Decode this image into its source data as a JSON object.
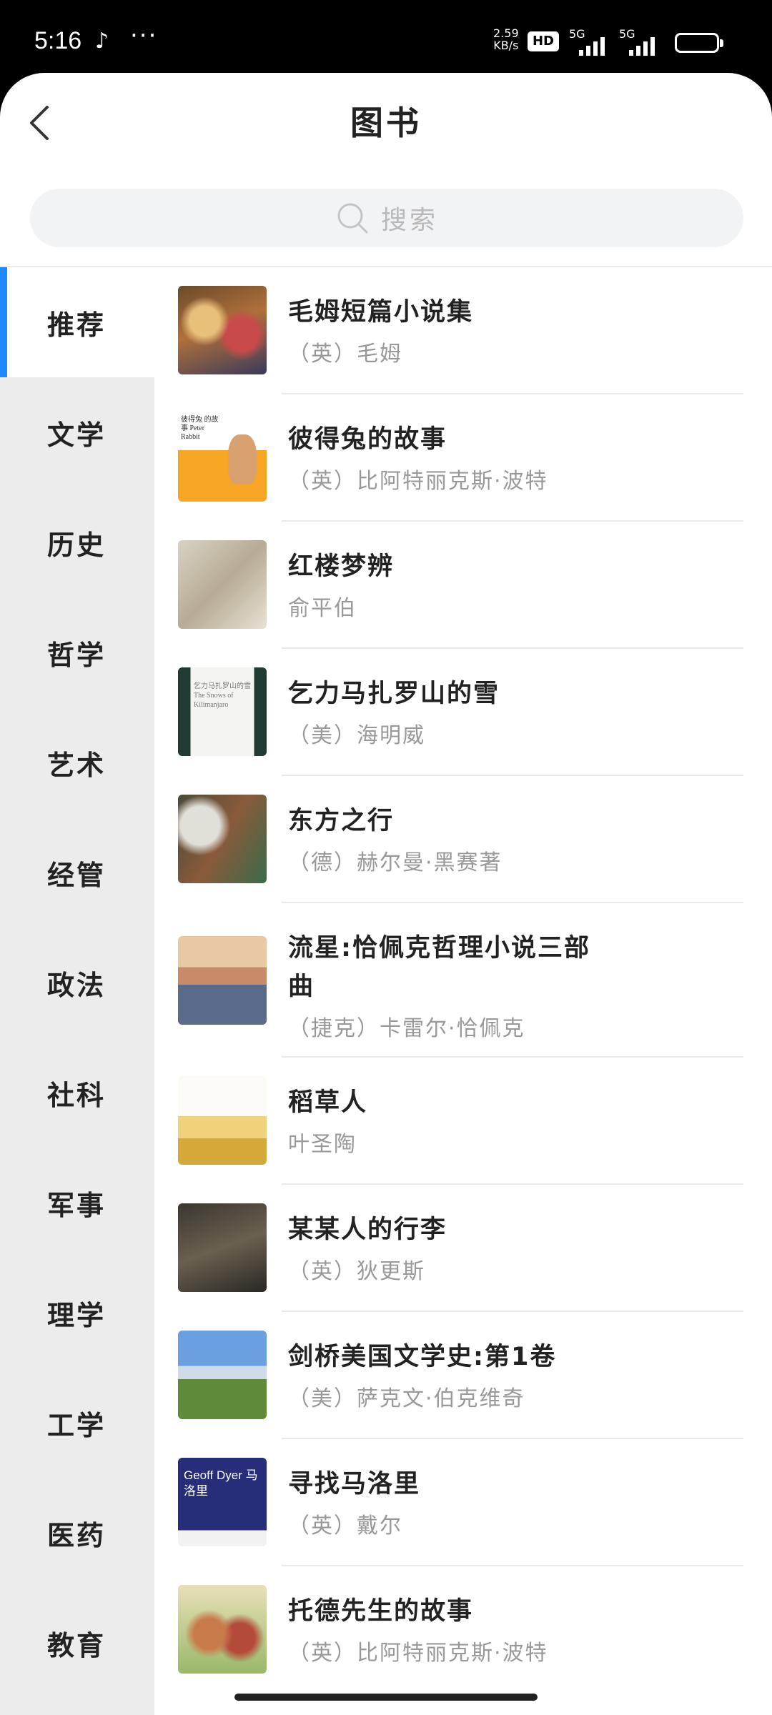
{
  "status_bar": {
    "time": "5:16",
    "net_speed_value": "2.59",
    "net_speed_unit": "KB/s",
    "hd_label": "HD",
    "signal1_label": "5G",
    "signal2_label": "5G"
  },
  "header": {
    "title": "图书",
    "back_icon": "chevron-left-icon"
  },
  "search": {
    "placeholder": "搜索",
    "icon": "search-icon"
  },
  "categories": [
    {
      "label": "推荐",
      "active": true
    },
    {
      "label": "文学"
    },
    {
      "label": "历史"
    },
    {
      "label": "哲学"
    },
    {
      "label": "艺术"
    },
    {
      "label": "经管"
    },
    {
      "label": "政法"
    },
    {
      "label": "社科"
    },
    {
      "label": "军事"
    },
    {
      "label": "理学"
    },
    {
      "label": "工学"
    },
    {
      "label": "医药"
    },
    {
      "label": "教育"
    }
  ],
  "books": [
    {
      "title": "毛姆短篇小说集",
      "author": "（英）毛姆"
    },
    {
      "title": "彼得兔的故事",
      "author": "（英）比阿特丽克斯·波特",
      "cover_text": "彼得兔 的故事 Peter Rabbit"
    },
    {
      "title": "红楼梦辨",
      "author": "俞平伯"
    },
    {
      "title": "乞力马扎罗山的雪",
      "author": "（美）海明威",
      "cover_text": "乞力马扎罗山的雪 The Snows of Kilimanjaro"
    },
    {
      "title": "东方之行",
      "author": "（德）赫尔曼·黑赛著"
    },
    {
      "title": "流星:恰佩克哲理小说三部曲",
      "author": "（捷克）卡雷尔·恰佩克"
    },
    {
      "title": "稻草人",
      "author": "叶圣陶"
    },
    {
      "title": "某某人的行李",
      "author": "（英）狄更斯"
    },
    {
      "title": "剑桥美国文学史:第1卷",
      "author": "（美）萨克文·伯克维奇"
    },
    {
      "title": "寻找马洛里",
      "author": "（英）戴尔",
      "cover_text": "Geoff Dyer 马洛里"
    },
    {
      "title": "托德先生的故事",
      "author": "（英）比阿特丽克斯·波特"
    }
  ],
  "colors": {
    "accent": "#1e88ff",
    "sidebar_bg": "#ececec",
    "author_text": "#999999"
  }
}
